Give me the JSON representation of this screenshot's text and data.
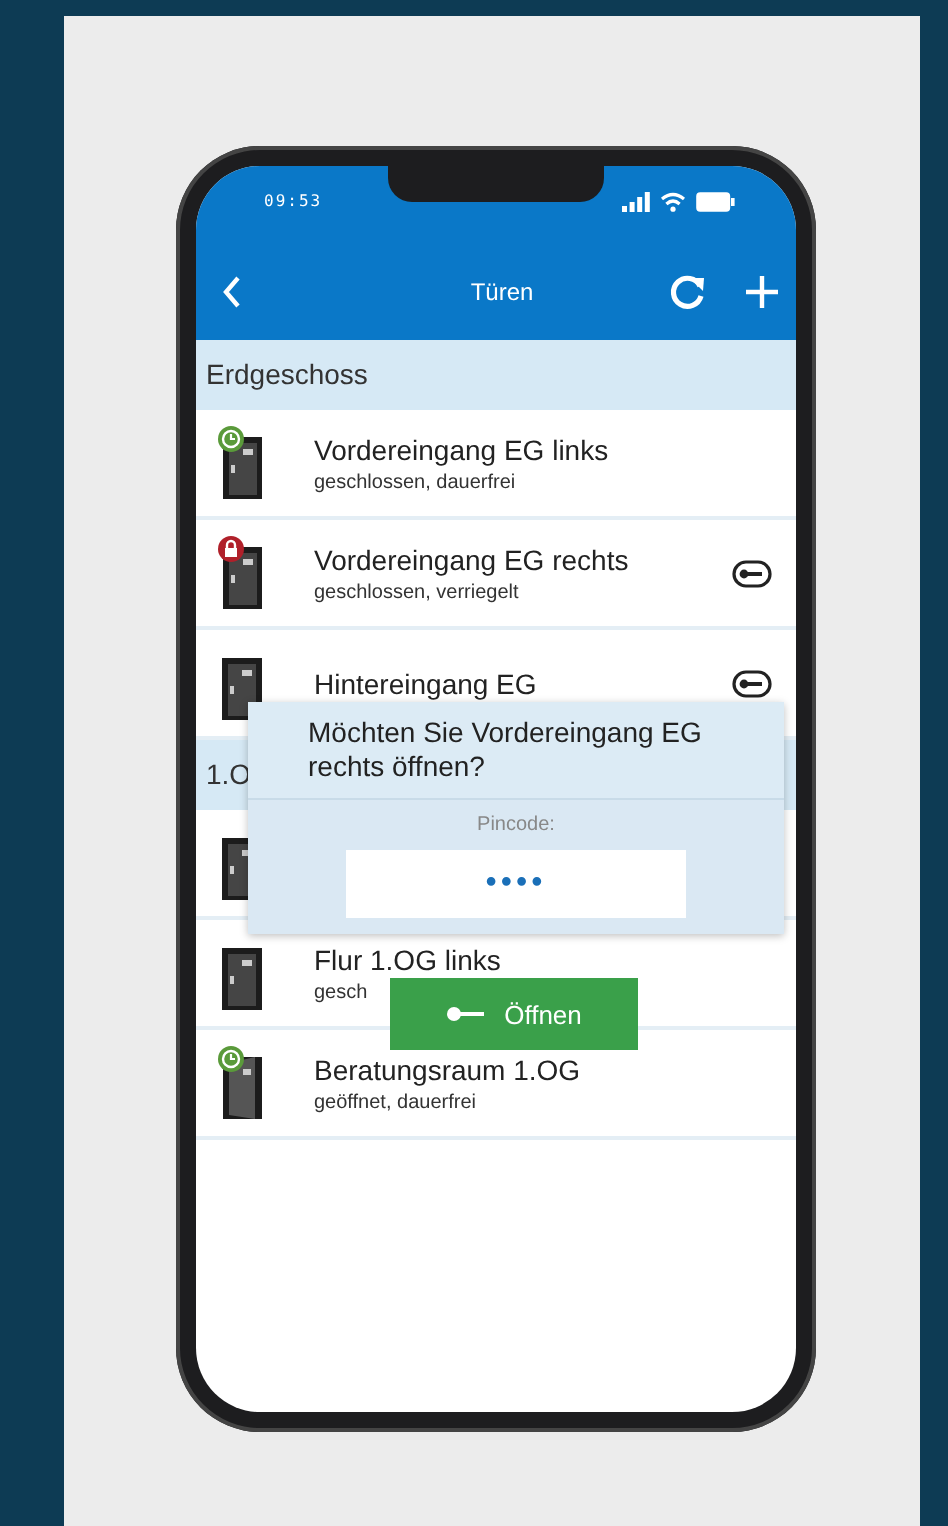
{
  "status_bar": {
    "time": "09:53"
  },
  "nav": {
    "title": "Türen"
  },
  "sections": [
    {
      "title": "Erdgeschoss",
      "rows": [
        {
          "title": "Vordereingang EG links",
          "status": "geschlossen, dauerfrei",
          "kind": "closed",
          "timer": true,
          "locked": false,
          "key_button": false
        },
        {
          "title": "Vordereingang EG rechts",
          "status": "geschlossen, verriegelt",
          "kind": "closed",
          "timer": false,
          "locked": true,
          "key_button": true
        },
        {
          "title": "Hintereingang EG",
          "kind": "closed",
          "timer": false,
          "locked": false,
          "key_button": true
        }
      ]
    },
    {
      "title": "1.O",
      "rows": [
        {
          "kind": "closed",
          "timer": false,
          "locked": false,
          "key_button": false
        },
        {
          "title": "Flur 1.OG links",
          "status": "gesch",
          "kind": "closed",
          "timer": false,
          "locked": false,
          "key_button": false
        },
        {
          "title": "Beratungsraum 1.OG",
          "status": "geöffnet, dauerfrei",
          "kind": "open",
          "timer": true,
          "locked": false,
          "key_button": false
        }
      ]
    }
  ],
  "dialog": {
    "message": "Möchten Sie Vordereingang EG rechts öffnen?",
    "pin_label": "Pincode:",
    "pin_value": "••••",
    "button": "Öffnen"
  }
}
